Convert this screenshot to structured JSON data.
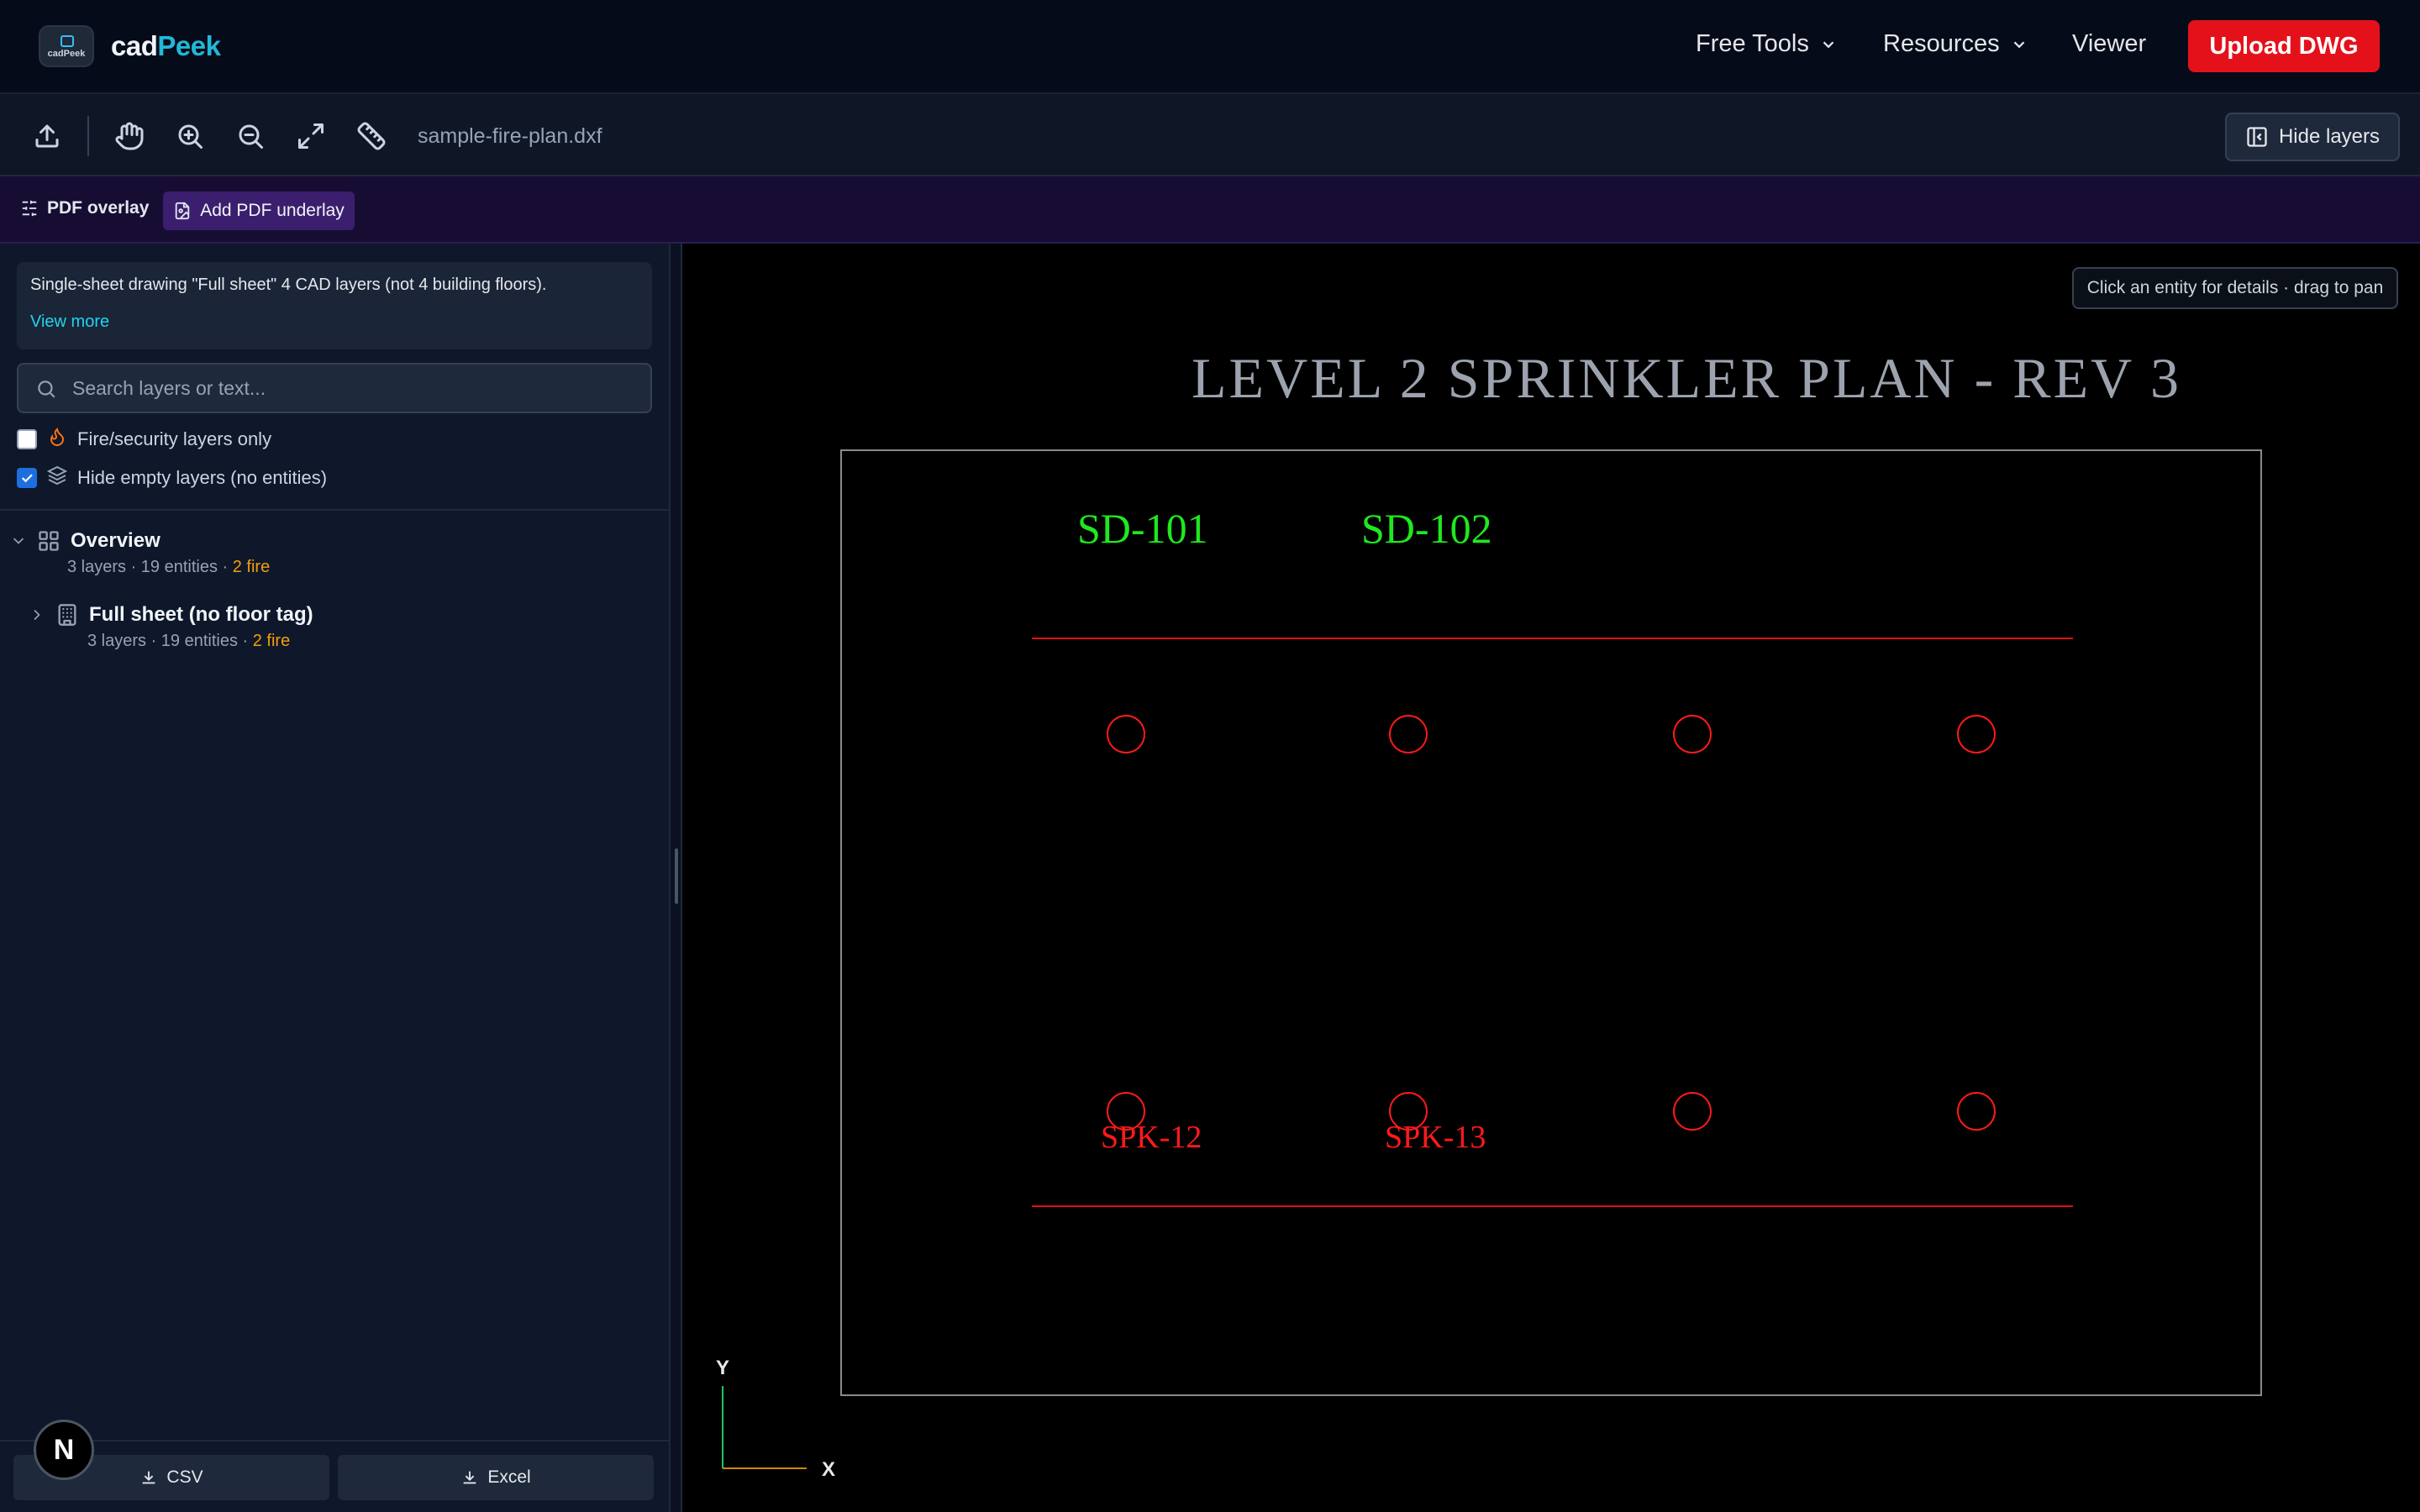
{
  "nav": {
    "brand_part1": "cad",
    "brand_part2": "Peek",
    "logo_text": "cadPeek",
    "items": [
      "Free Tools",
      "Resources",
      "Viewer"
    ],
    "upload_label": "Upload DWG",
    "accent": "#e5111a",
    "brand_color": "#22b8d6"
  },
  "toolbar": {
    "icons": [
      "upload-icon",
      "hand-pan-icon",
      "zoom-in-icon",
      "zoom-out-icon",
      "fit-expand-icon",
      "ruler-measure-icon"
    ],
    "filename": "sample-fire-plan.dxf",
    "hide_layers_label": "Hide layers"
  },
  "pdfbar": {
    "overlay_label": "PDF overlay",
    "underlay_label": "Add PDF underlay"
  },
  "sidebar": {
    "info_text": "Single-sheet drawing \"Full sheet\" 4 CAD layers (not 4 building floors).",
    "view_more": "View more",
    "search_placeholder": "Search layers or text...",
    "filters": [
      {
        "label": "Fire/security layers only",
        "checked": false
      },
      {
        "label": "Hide empty layers (no entities)",
        "checked": true
      }
    ],
    "tree": [
      {
        "title": "Overview",
        "meta": "3 layers · 19 entities · ",
        "fire": "2 fire",
        "expanded": true
      },
      {
        "title": "Full sheet (no floor tag)",
        "meta": "3 layers · 19 entities · ",
        "fire": "2 fire",
        "expanded": false
      }
    ],
    "export_buttons": [
      "CSV",
      "Excel"
    ],
    "badge": "N"
  },
  "canvas": {
    "hint": "Click an entity for details · drag to pan",
    "title": "LEVEL 2 SPRINKLER PLAN - REV 3",
    "detector_labels": [
      "SD-101",
      "SD-102"
    ],
    "sprinkler_labels": [
      "SPK-12",
      "SPK-13"
    ],
    "axis_x": "X",
    "axis_y": "Y",
    "colors": {
      "title": "#9ca3af",
      "detector": "#1fe81f",
      "sprinkler": "#ff1a1a"
    }
  }
}
